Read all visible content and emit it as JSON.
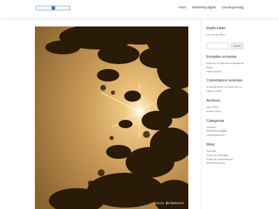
{
  "header": {
    "nav": [
      "Inicio",
      "Marketing digital",
      "Uncategorized"
    ],
    "search_icon": "search-icon"
  },
  "hero": {
    "credit": "Lucia Berbenazzi"
  },
  "sidebar": {
    "site_title": "Radio Halel",
    "site_tagline": "Lá voz de Dios",
    "search_button": "Buscar",
    "recent_posts": {
      "title": "Entradas recientes",
      "items": [
        "Esta es mi primera entrada de Blog",
        "Hello world!"
      ]
    },
    "recent_comments": {
      "title": "Comentarios recientes",
      "items": [
        "A WordPress Commenter en Hello world!"
      ]
    },
    "archives": {
      "title": "Archivos",
      "items": [
        "julio 2019",
        "enero 2019"
      ]
    },
    "categories": {
      "title": "Categorías",
      "items": [
        "Internet",
        "Marketing digital",
        "Uncategorized"
      ]
    },
    "meta": {
      "title": "Meta",
      "items": [
        "Acceder",
        "Feed de entradas",
        "Feed de comentarios",
        "WordPress.org"
      ]
    }
  },
  "colors": {
    "accent": "#2ea3f2",
    "logo_mark": "#3b73c4",
    "photo_sky": "#c99a57"
  }
}
